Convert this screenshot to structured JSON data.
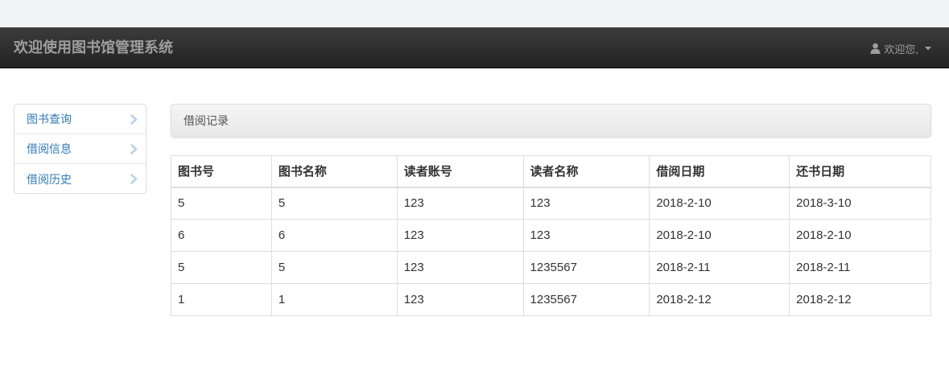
{
  "header": {
    "title": "欢迎使用图书馆管理系统",
    "user_greeting": "欢迎您,"
  },
  "sidebar": {
    "items": [
      {
        "label": "图书查询",
        "icon": "chevron-right-icon"
      },
      {
        "label": "借阅信息",
        "icon": "chevron-right-icon"
      },
      {
        "label": "借阅历史",
        "icon": "chevron-right-icon"
      }
    ]
  },
  "panel": {
    "title": "借阅记录"
  },
  "table": {
    "columns": [
      "图书号",
      "图书名称",
      "读者账号",
      "读者名称",
      "借阅日期",
      "还书日期"
    ],
    "rows": [
      [
        "5",
        "5",
        "123",
        "123",
        "2018-2-10",
        "2018-3-10"
      ],
      [
        "6",
        "6",
        "123",
        "123",
        "2018-2-10",
        "2018-2-10"
      ],
      [
        "5",
        "5",
        "123",
        "1235567",
        "2018-2-11",
        "2018-2-11"
      ],
      [
        "1",
        "1",
        "123",
        "1235567",
        "2018-2-12",
        "2018-2-12"
      ]
    ]
  },
  "colors": {
    "navbar": "#222222",
    "navbar_text": "#9d9d9d",
    "link": "#337ab7",
    "chevron": "#b9d3ec",
    "border": "#dddddd"
  }
}
